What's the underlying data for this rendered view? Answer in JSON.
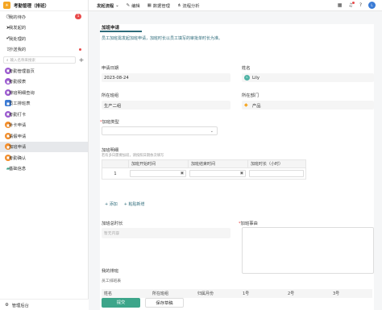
{
  "app": {
    "title": "考勤管理（排班）",
    "logo": "☀"
  },
  "sidebar": {
    "top_items": [
      {
        "label": "我的待办",
        "icon": "clock-icon",
        "badge": "1"
      },
      {
        "label": "我发起的",
        "icon": "send-icon"
      },
      {
        "label": "我处理的",
        "icon": "check-icon"
      },
      {
        "label": "抄送我的",
        "icon": "share-icon",
        "dot": true
      }
    ],
    "search_placeholder": "输入名称来搜索",
    "apps": [
      {
        "label": "考勤管理首页",
        "color": "#9b59d0"
      },
      {
        "label": "考勤报表",
        "color": "#9b59d0"
      },
      {
        "label": "排班明细查询",
        "color": "#9b59d0"
      },
      {
        "label": "员工排班表",
        "color": "#3a7bd5"
      },
      {
        "label": "考勤打卡",
        "color": "#9b59d0"
      },
      {
        "label": "补卡申请",
        "color": "#f28c28"
      },
      {
        "label": "请假申请",
        "color": "#f28c28"
      },
      {
        "label": "加班申请",
        "color": "#f28c28",
        "active": true
      },
      {
        "label": "考勤确认",
        "color": "#f28c28"
      },
      {
        "label": "基础信息",
        "color": "#3da58a",
        "folder": true
      }
    ],
    "footer_label": "管理后台"
  },
  "topbar": {
    "items": [
      "发起流程",
      "编辑",
      "数据管理",
      "流程分析"
    ]
  },
  "form": {
    "tab": "加班申请",
    "description": "员工加班需发起加班申请，加班时长以员工填写的审批单时长为准。",
    "apply_date_label": "申请日期",
    "apply_date": "2023-08-24",
    "name_label": "姓名",
    "name_value": "Lily",
    "group_label": "所在班组",
    "group_value": "生产二组",
    "dept_label": "所在部门",
    "dept_value": "产品",
    "type_label": "加班类型",
    "detail_label": "加班明细",
    "detail_hint": "若有多日需要加班，请按照日期依次填写",
    "detail_columns": [
      "加班开始时间",
      "加班结束时间",
      "加班时长（小时）"
    ],
    "detail_row_no": "1",
    "add_link": "+ 添加",
    "paste_link": "+ 粘贴新增",
    "total_label": "加班总时长",
    "total_placeholder": "暂无内容",
    "reason_label": "加班事由",
    "schedule_label": "我的排班",
    "schedule_subtitle": "员工排班表",
    "schedule_columns": [
      "姓名",
      "所在班组",
      "归属月份",
      "1号",
      "2号",
      "3号"
    ],
    "submit_label": "提交",
    "draft_label": "保存草稿"
  }
}
